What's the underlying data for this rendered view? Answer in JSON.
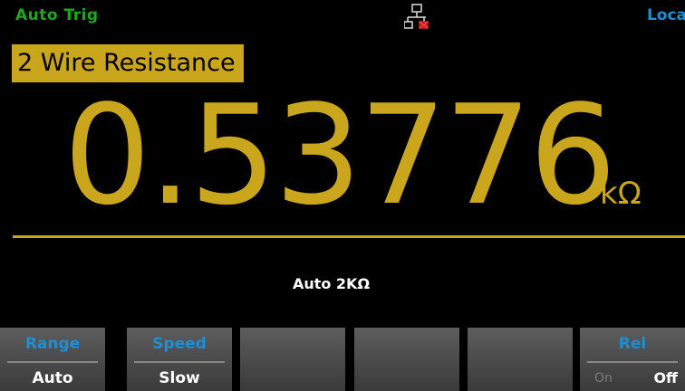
{
  "status_bar": {
    "trigger": "Auto Trig",
    "remote": "Loca",
    "network_icon": "lan-disconnected-icon"
  },
  "display": {
    "function": "2 Wire Resistance",
    "reading": "0.53776",
    "unit": "kΩ",
    "range_info": "Auto  2KΩ"
  },
  "softkeys": [
    {
      "title": "Range",
      "value": "Auto"
    },
    {
      "title": "Speed",
      "value": "Slow"
    },
    {
      "title": "",
      "value": ""
    },
    {
      "title": "",
      "value": ""
    },
    {
      "title": "",
      "value": ""
    },
    {
      "title": "Rel",
      "options": [
        "On",
        "Off"
      ],
      "selected": "Off"
    }
  ],
  "colors": {
    "background": "#000000",
    "accent_yellow": "#c9a61c",
    "trigger_green": "#1fa81f",
    "label_blue": "#1c8fd6",
    "softkey_bg": "#4a4a4a",
    "inactive_gray": "#7a7a7a"
  }
}
